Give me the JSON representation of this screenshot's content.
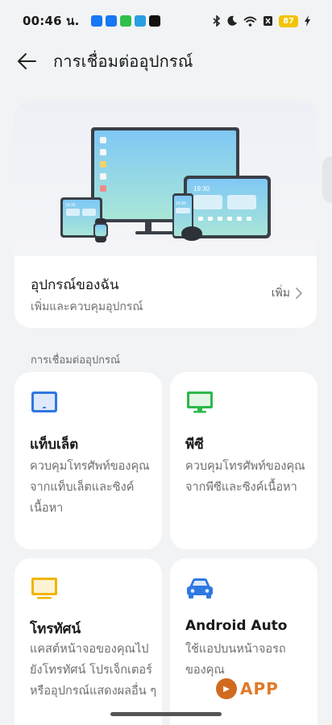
{
  "status_bar": {
    "time": "00:46 น.",
    "battery": "87",
    "notification_icons": [
      "facebook-icon",
      "facebook-icon",
      "line-icon",
      "messages-icon",
      "tiktok-icon"
    ],
    "system_icons": [
      "bluetooth-icon",
      "moon-icon",
      "wifi-icon",
      "no-sim-icon",
      "battery-icon",
      "charging-icon"
    ]
  },
  "header": {
    "title": "การเชื่อมต่ออุปกรณ์"
  },
  "hero": {
    "illustration_times": [
      "19:30",
      "19:30",
      "19:30"
    ],
    "my_devices_title": "อุปกรณ์ของฉัน",
    "my_devices_subtitle": "เพิ่มและควบคุมอุปกรณ์",
    "add_label": "เพิ่ม"
  },
  "section": {
    "label": "การเชื่อมต่ออุปกรณ์"
  },
  "tiles": [
    {
      "title": "แท็บเล็ต",
      "description": "ควบคุมโทรศัพท์ของคุณจากแท็บเล็ตและซิงค์เนื้อหา",
      "icon": "tablet-icon",
      "color": "#2f78e0"
    },
    {
      "title": "พีซี",
      "description": "ควบคุมโทรศัพท์ของคุณจากพีซีและซิงค์เนื้อหา",
      "icon": "monitor-icon",
      "color": "#2db84c"
    },
    {
      "title": "โทรทัศน์",
      "description": "แคสต์หน้าจอของคุณไปยังโทรทัศน์ โปรเจ็กเตอร์ หรืออุปกรณ์แสดงผลอื่น ๆ",
      "icon": "tv-icon",
      "color": "#f1b500"
    },
    {
      "title": "Android Auto",
      "description": "ใช้แอปบนหน้าจอรถของคุณ",
      "icon": "car-icon",
      "color": "#2f78e0"
    }
  ],
  "watermark": {
    "text": "APP"
  }
}
